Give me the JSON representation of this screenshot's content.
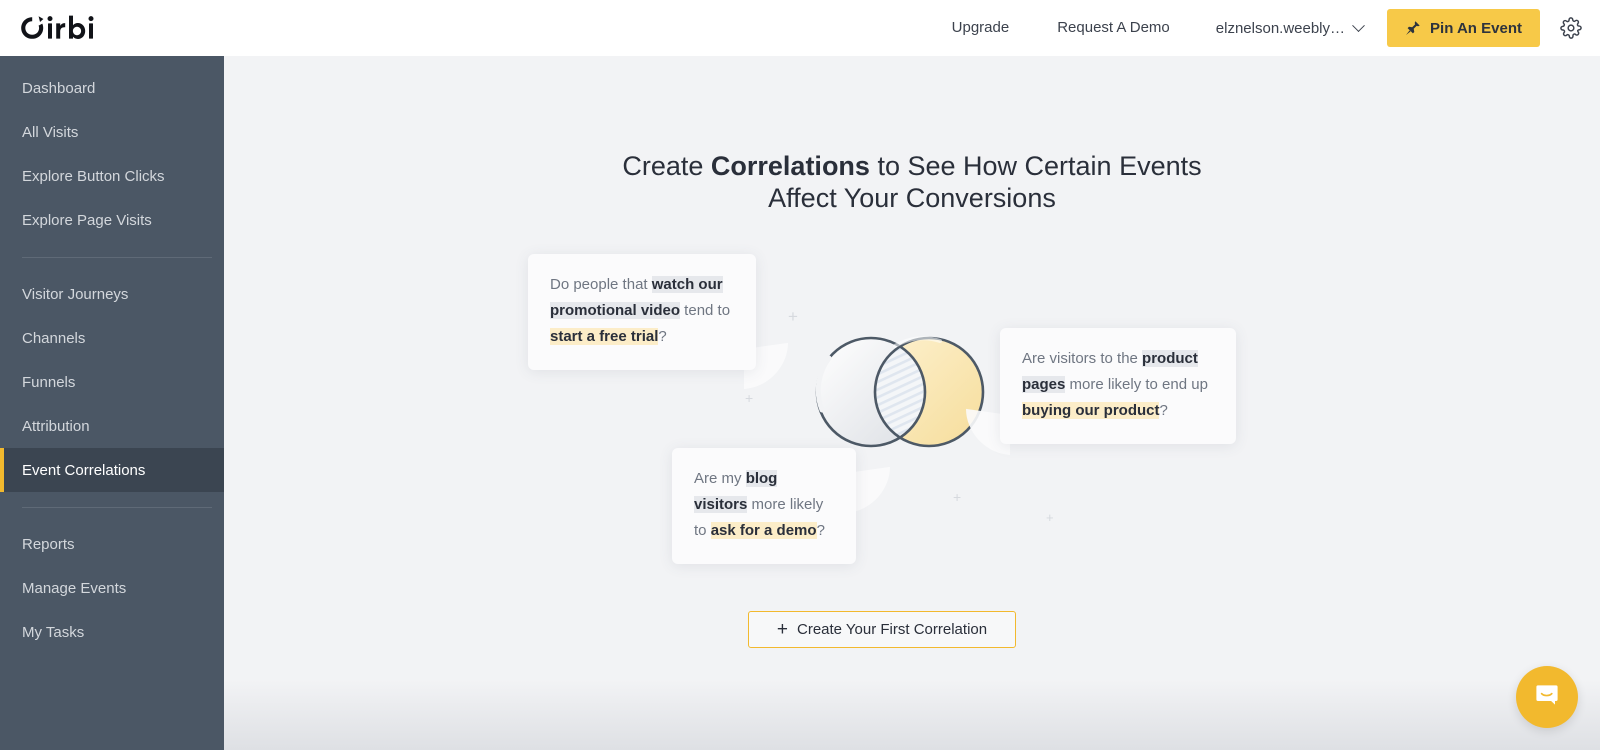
{
  "header": {
    "logo_text": "Oribi",
    "nav": [
      {
        "label": "Upgrade",
        "name": "nav-upgrade"
      },
      {
        "label": "Request A Demo",
        "name": "nav-request-a-demo"
      }
    ],
    "account_label": "elznelson.weebly…",
    "pin_button_label": "Pin An Event",
    "settings_icon": "gear-icon",
    "pin_icon": "pushpin-icon",
    "chevron_icon": "chevron-down-icon"
  },
  "sidebar": {
    "groups": [
      {
        "items": [
          {
            "label": "Dashboard",
            "name": "sidebar-item-dashboard",
            "active": false
          },
          {
            "label": "All Visits",
            "name": "sidebar-item-all-visits",
            "active": false
          },
          {
            "label": "Explore Button Clicks",
            "name": "sidebar-item-explore-button-clicks",
            "active": false
          },
          {
            "label": "Explore Page Visits",
            "name": "sidebar-item-explore-page-visits",
            "active": false
          }
        ]
      },
      {
        "items": [
          {
            "label": "Visitor Journeys",
            "name": "sidebar-item-visitor-journeys",
            "active": false
          },
          {
            "label": "Channels",
            "name": "sidebar-item-channels",
            "active": false
          },
          {
            "label": "Funnels",
            "name": "sidebar-item-funnels",
            "active": false
          },
          {
            "label": "Attribution",
            "name": "sidebar-item-attribution",
            "active": false
          },
          {
            "label": "Event Correlations",
            "name": "sidebar-item-event-correlations",
            "active": true
          }
        ]
      },
      {
        "items": [
          {
            "label": "Reports",
            "name": "sidebar-item-reports",
            "active": false
          },
          {
            "label": "Manage Events",
            "name": "sidebar-item-manage-events",
            "active": false
          },
          {
            "label": "My Tasks",
            "name": "sidebar-item-my-tasks",
            "active": false
          }
        ]
      }
    ]
  },
  "main": {
    "headline": {
      "part1": "Create ",
      "bold1": "Correlations",
      "part2": " to See How Certain Events",
      "line2": "Affect Your Conversions"
    },
    "bubbles": [
      {
        "name": "bubble-promotional-video",
        "segments": [
          {
            "text": "Do people that ",
            "style": "plain"
          },
          {
            "text": "watch our promotional video",
            "style": "gray"
          },
          {
            "text": " tend to ",
            "style": "plain"
          },
          {
            "text": "start a free trial",
            "style": "yellow"
          },
          {
            "text": "?",
            "style": "plain"
          }
        ]
      },
      {
        "name": "bubble-product-pages",
        "segments": [
          {
            "text": "Are visitors to the ",
            "style": "plain"
          },
          {
            "text": "product pages",
            "style": "gray"
          },
          {
            "text": " more likely to end up ",
            "style": "plain"
          },
          {
            "text": "buying our product",
            "style": "yellow"
          },
          {
            "text": "?",
            "style": "plain"
          }
        ]
      },
      {
        "name": "bubble-blog-visitors",
        "segments": [
          {
            "text": "Are my ",
            "style": "plain"
          },
          {
            "text": "blog visitors",
            "style": "gray"
          },
          {
            "text": " more likely to ",
            "style": "plain"
          },
          {
            "text": "ask for a demo",
            "style": "yellow"
          },
          {
            "text": "?",
            "style": "plain"
          }
        ]
      }
    ],
    "cta_label": "Create Your First Correlation",
    "cta_icon": "plus-icon",
    "venn_icon": "venn-diagram-illustration"
  },
  "chat": {
    "icon": "chat-bubble-icon"
  },
  "colors": {
    "brand_yellow": "#f7c948",
    "accent_yellow": "#f2b92e",
    "sidebar_bg": "#4b5765",
    "sidebar_active_bg": "#3b4551",
    "main_bg": "#f2f3f5",
    "highlight_gray": "#e6e8ec",
    "highlight_yellow": "#fcedc8",
    "text_dark": "#2a2f3a"
  }
}
